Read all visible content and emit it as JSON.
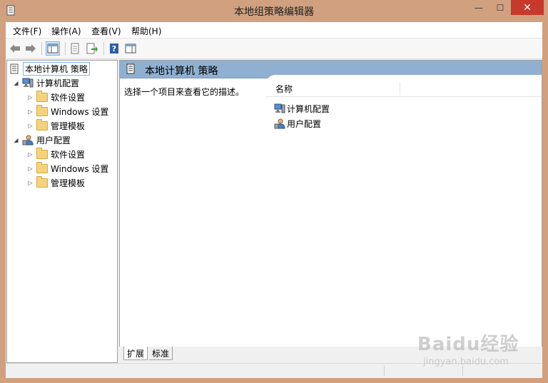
{
  "window": {
    "title": "本地组策略编辑器",
    "controls": {
      "minimize": "—",
      "maximize": "☐",
      "close": "✕"
    }
  },
  "menu": [
    "文件(F)",
    "操作(A)",
    "查看(V)",
    "帮助(H)"
  ],
  "toolbar": [
    {
      "name": "back-icon"
    },
    {
      "name": "forward-icon"
    },
    {
      "name": "show-hide-tree-icon"
    },
    {
      "name": "properties-icon"
    },
    {
      "name": "export-list-icon"
    },
    {
      "name": "help-icon"
    },
    {
      "name": "show-hide-action-pane-icon"
    }
  ],
  "tree": {
    "root": "本地计算机 策略",
    "computer": {
      "label": "计算机配置",
      "children": [
        "软件设置",
        "Windows 设置",
        "管理模板"
      ]
    },
    "user": {
      "label": "用户配置",
      "children": [
        "软件设置",
        "Windows 设置",
        "管理模板"
      ]
    }
  },
  "content": {
    "title": "本地计算机 策略",
    "description": "选择一个项目来查看它的描述。",
    "column_name": "名称",
    "items": [
      "计算机配置",
      "用户配置"
    ]
  },
  "tabs": [
    "扩展",
    "标准"
  ],
  "watermark": {
    "brand": "Baidu经验",
    "url": "jingyan.baidu.com"
  },
  "colors": {
    "header_bar": "#8fb0d0",
    "title_bar": "#d0a07f",
    "close_button": "#c7392b",
    "folder": "#f6d37a"
  }
}
